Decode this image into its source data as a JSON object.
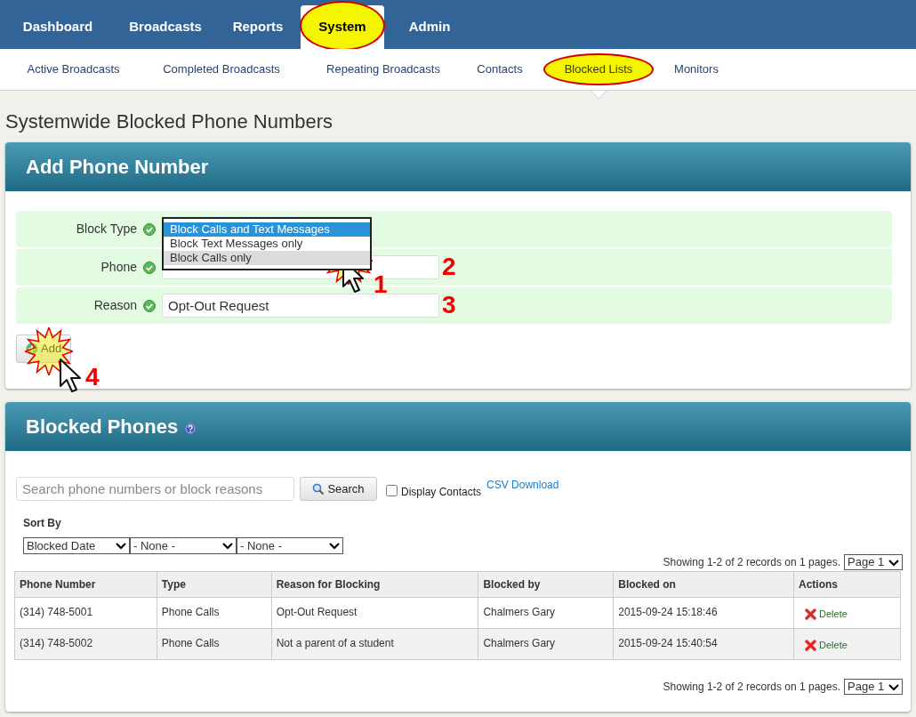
{
  "main_nav": [
    {
      "label": "Dashboard",
      "selected": false,
      "highlighted": false
    },
    {
      "label": "Broadcasts",
      "selected": false,
      "highlighted": false
    },
    {
      "label": "Reports",
      "selected": false,
      "highlighted": false
    },
    {
      "label": "System",
      "selected": true,
      "highlighted": true
    },
    {
      "label": "Admin",
      "selected": false,
      "highlighted": false
    }
  ],
  "sub_nav": [
    {
      "label": "Active Broadcasts",
      "selected": false,
      "highlighted": false
    },
    {
      "label": "Completed Broadcasts",
      "selected": false,
      "highlighted": false
    },
    {
      "label": "Repeating Broadcasts",
      "selected": false,
      "highlighted": false
    },
    {
      "label": "Contacts",
      "selected": false,
      "highlighted": false
    },
    {
      "label": "Blocked Lists",
      "selected": true,
      "highlighted": true
    },
    {
      "label": "Monitors",
      "selected": false,
      "highlighted": false
    }
  ],
  "page_title": "Systemwide Blocked Phone Numbers",
  "add_panel": {
    "title": "Add Phone Number",
    "fields": [
      {
        "label": "Block Type",
        "kind": "select"
      },
      {
        "label": "Phone",
        "kind": "text"
      },
      {
        "label": "Reason",
        "kind": "text",
        "value": "Opt-Out Request"
      }
    ],
    "block_type_options": [
      {
        "label": "Block Calls and Text Messages",
        "selected": true,
        "hovered": false
      },
      {
        "label": "Block Text Messages only",
        "selected": false,
        "hovered": false
      },
      {
        "label": "Block Calls only",
        "selected": false,
        "hovered": true
      }
    ],
    "add_button": "Add"
  },
  "blocked_panel": {
    "title": "Blocked Phones",
    "search": {
      "placeholder": "Search phone numbers or block reasons"
    },
    "search_button": "Search",
    "display_contacts": {
      "label": "Display Contacts",
      "checked": false
    },
    "csv_link": "CSV Download",
    "sort_by_label": "Sort By",
    "sort_selects": [
      "Blocked Date",
      "- None -",
      "- None -"
    ],
    "paging_top": {
      "text": "Showing 1-2 of 2 records on 1 pages.",
      "page": "Page 1"
    },
    "table": {
      "columns": [
        "Phone Number",
        "Type",
        "Reason for Blocking",
        "Blocked by",
        "Blocked on",
        "Actions"
      ],
      "rows": [
        {
          "phone": "(314) 748-5001",
          "type": "Phone Calls",
          "reason": "Opt-Out Request",
          "blocked_by": "Chalmers Gary",
          "blocked_on": "2015-09-24 15:18:46",
          "action": "Delete"
        },
        {
          "phone": "(314) 748-5002",
          "type": "Phone Calls",
          "reason": "Not a parent of a student",
          "blocked_by": "Chalmers Gary",
          "blocked_on": "2015-09-24 15:40:54",
          "action": "Delete"
        }
      ]
    },
    "paging_bottom": {
      "text": "Showing 1-2 of 2 records on 1 pages.",
      "page": "Page 1"
    }
  },
  "callouts": [
    {
      "label": "1",
      "pointer": true
    },
    {
      "label": "2",
      "pointer": false
    },
    {
      "label": "3",
      "pointer": false
    },
    {
      "label": "4",
      "pointer": true
    }
  ]
}
